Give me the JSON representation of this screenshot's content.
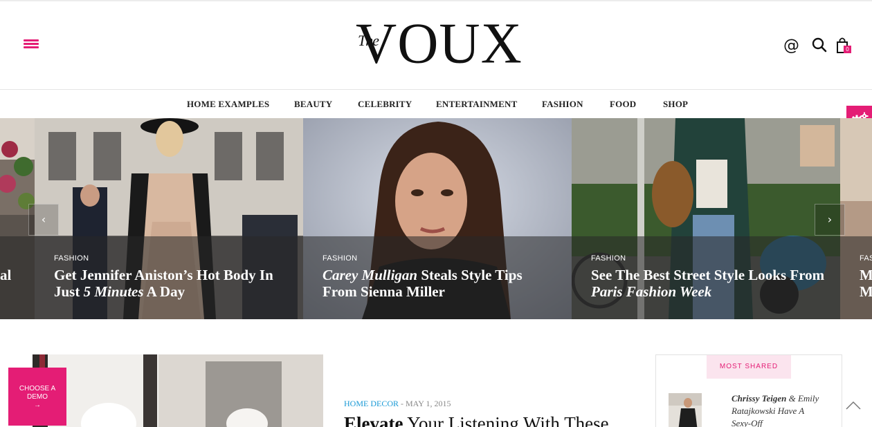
{
  "brand": {
    "logo_small": "The",
    "logo_main": "VOUX",
    "accent": "#e41d75"
  },
  "header": {
    "icons": [
      "menu-icon",
      "at-icon",
      "search-icon",
      "shopping-bag-icon"
    ],
    "at_symbol": "@",
    "cart_count": "0"
  },
  "nav": {
    "items": [
      {
        "label": "HOME EXAMPLES"
      },
      {
        "label": "BEAUTY"
      },
      {
        "label": "CELEBRITY"
      },
      {
        "label": "ENTERTAINMENT"
      },
      {
        "label": "FASHION"
      },
      {
        "label": "FOOD"
      },
      {
        "label": "SHOP"
      }
    ]
  },
  "slider": {
    "slides": [
      {
        "category": "",
        "title_parts": [
          "al"
        ]
      },
      {
        "category": "FASHION",
        "title_parts": [
          "Get Jennifer Aniston’s Hot Body In Just ",
          "5 Minutes",
          " A Day"
        ]
      },
      {
        "category": "FASHION",
        "title_parts": [
          "Carey Mulligan",
          " Steals Style Tips From Sienna Miller"
        ]
      },
      {
        "category": "FASHION",
        "title_parts": [
          "See The Best Street Style Looks From ",
          "Paris Fashion Week"
        ]
      },
      {
        "category": "FAS",
        "title_parts": [
          "M",
          "M"
        ]
      }
    ],
    "prev_label": "‹",
    "next_label": "›"
  },
  "demo_button": {
    "line1": "CHOOSE A",
    "line2": "DEMO",
    "arrow": "→"
  },
  "featured_post": {
    "category": "HOME DECOR",
    "separator": " - ",
    "date": "MAY 1, 2015",
    "title_bold": "Elevate",
    "title_rest": " Your Listening With These"
  },
  "sidebar": {
    "heading": "MOST SHARED",
    "item": {
      "name_bold": "Chrissy Teigen",
      "rest_line1": " & Emily",
      "line2": "Ratajkowski Have A",
      "line3": "Sexy-Off"
    }
  }
}
